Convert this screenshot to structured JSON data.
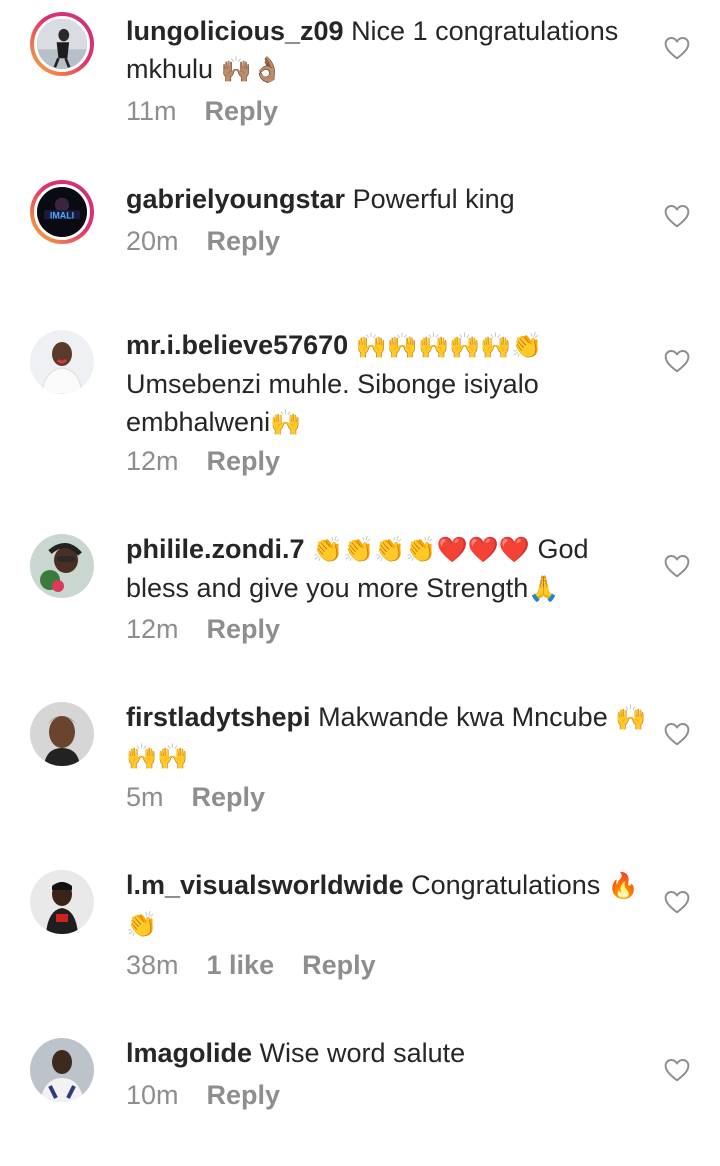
{
  "comments": [
    {
      "username": "lungolicious_z09",
      "text": "Nice 1 congratulations mkhulu",
      "emoji": "🙌🏽👌🏽",
      "time": "11m",
      "likes": "",
      "reply": "Reply"
    },
    {
      "username": "gabrielyoungstar",
      "text": "Powerful king",
      "emoji": "",
      "time": "20m",
      "likes": "",
      "reply": "Reply"
    },
    {
      "username": "mr.i.believe57670",
      "emoji_lead": "🙌🙌🙌🙌🙌👏",
      "text": "Umsebenzi muhle. Sibonge isiyalo embhalweni",
      "emoji": "🙌",
      "time": "12m",
      "likes": "",
      "reply": "Reply"
    },
    {
      "username": "philile.zondi.7",
      "emoji_lead": "👏👏👏👏❤️❤️❤️",
      "text": "God bless and give you more Strength",
      "emoji": "🙏",
      "time": "12m",
      "likes": "",
      "reply": "Reply"
    },
    {
      "username": "firstladytshepi",
      "text": "Makwande kwa Mncube",
      "emoji": "🙌🙌🙌",
      "time": "5m",
      "likes": "",
      "reply": "Reply"
    },
    {
      "username": "l.m_visualsworldwide",
      "text": "Congratulations",
      "emoji": "🔥👏",
      "time": "38m",
      "likes": "1 like",
      "reply": "Reply"
    },
    {
      "username": "lmagolide",
      "text": "Wise word salute",
      "emoji": "",
      "time": "10m",
      "likes": "",
      "reply": "Reply"
    }
  ],
  "icons": {
    "like": "heart-outline-icon"
  },
  "colors": {
    "text": "#262626",
    "meta": "#8e8e8e",
    "ring_start": "#f7b733",
    "ring_end": "#c13584"
  }
}
